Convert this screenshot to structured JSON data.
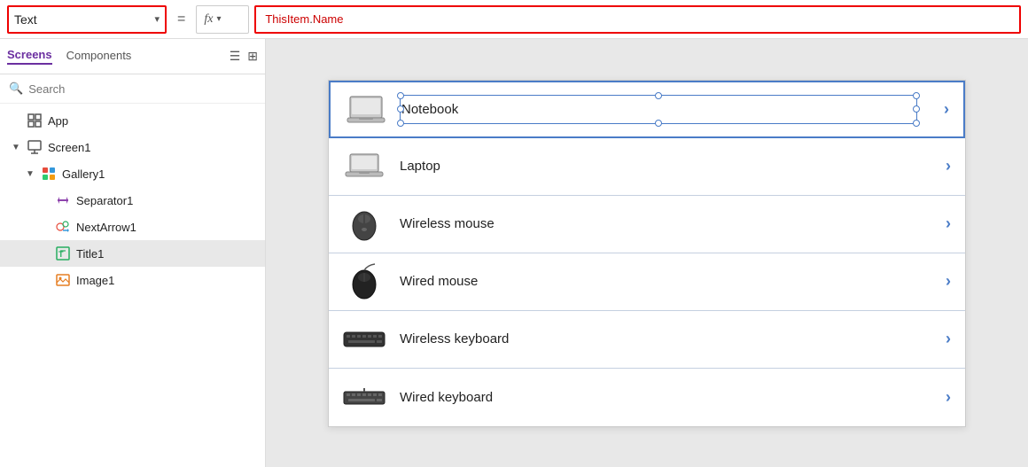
{
  "topbar": {
    "property_label": "Text",
    "chevron": "▾",
    "equals": "=",
    "fx_label": "fx",
    "formula": "ThisItem.Name"
  },
  "sidebar": {
    "tabs": [
      {
        "id": "screens",
        "label": "Screens",
        "active": true
      },
      {
        "id": "components",
        "label": "Components",
        "active": false
      }
    ],
    "search_placeholder": "Search",
    "tree": [
      {
        "id": "app",
        "label": "App",
        "indent": 0,
        "icon": "app",
        "arrow": "",
        "selected": false
      },
      {
        "id": "screen1",
        "label": "Screen1",
        "indent": 0,
        "icon": "screen",
        "arrow": "▶",
        "selected": false,
        "expanded": true
      },
      {
        "id": "gallery1",
        "label": "Gallery1",
        "indent": 1,
        "icon": "gallery",
        "arrow": "▶",
        "selected": false,
        "expanded": true
      },
      {
        "id": "separator1",
        "label": "Separator1",
        "indent": 2,
        "icon": "separator",
        "arrow": "",
        "selected": false
      },
      {
        "id": "nextarrow1",
        "label": "NextArrow1",
        "indent": 2,
        "icon": "nextarrow",
        "arrow": "",
        "selected": false
      },
      {
        "id": "title1",
        "label": "Title1",
        "indent": 2,
        "icon": "title",
        "arrow": "",
        "selected": true
      },
      {
        "id": "image1",
        "label": "Image1",
        "indent": 2,
        "icon": "image",
        "arrow": "",
        "selected": false
      }
    ]
  },
  "gallery": {
    "items": [
      {
        "id": "notebook",
        "name": "Notebook",
        "icon": "🖥",
        "selected": true
      },
      {
        "id": "laptop",
        "name": "Laptop",
        "icon": "💻",
        "selected": false
      },
      {
        "id": "wireless-mouse",
        "name": "Wireless mouse",
        "icon": "🖱",
        "selected": false
      },
      {
        "id": "wired-mouse",
        "name": "Wired mouse",
        "icon": "🖱",
        "selected": false
      },
      {
        "id": "wireless-keyboard",
        "name": "Wireless keyboard",
        "icon": "⌨",
        "selected": false
      },
      {
        "id": "wired-keyboard",
        "name": "Wired keyboard",
        "icon": "⌨",
        "selected": false
      }
    ]
  }
}
